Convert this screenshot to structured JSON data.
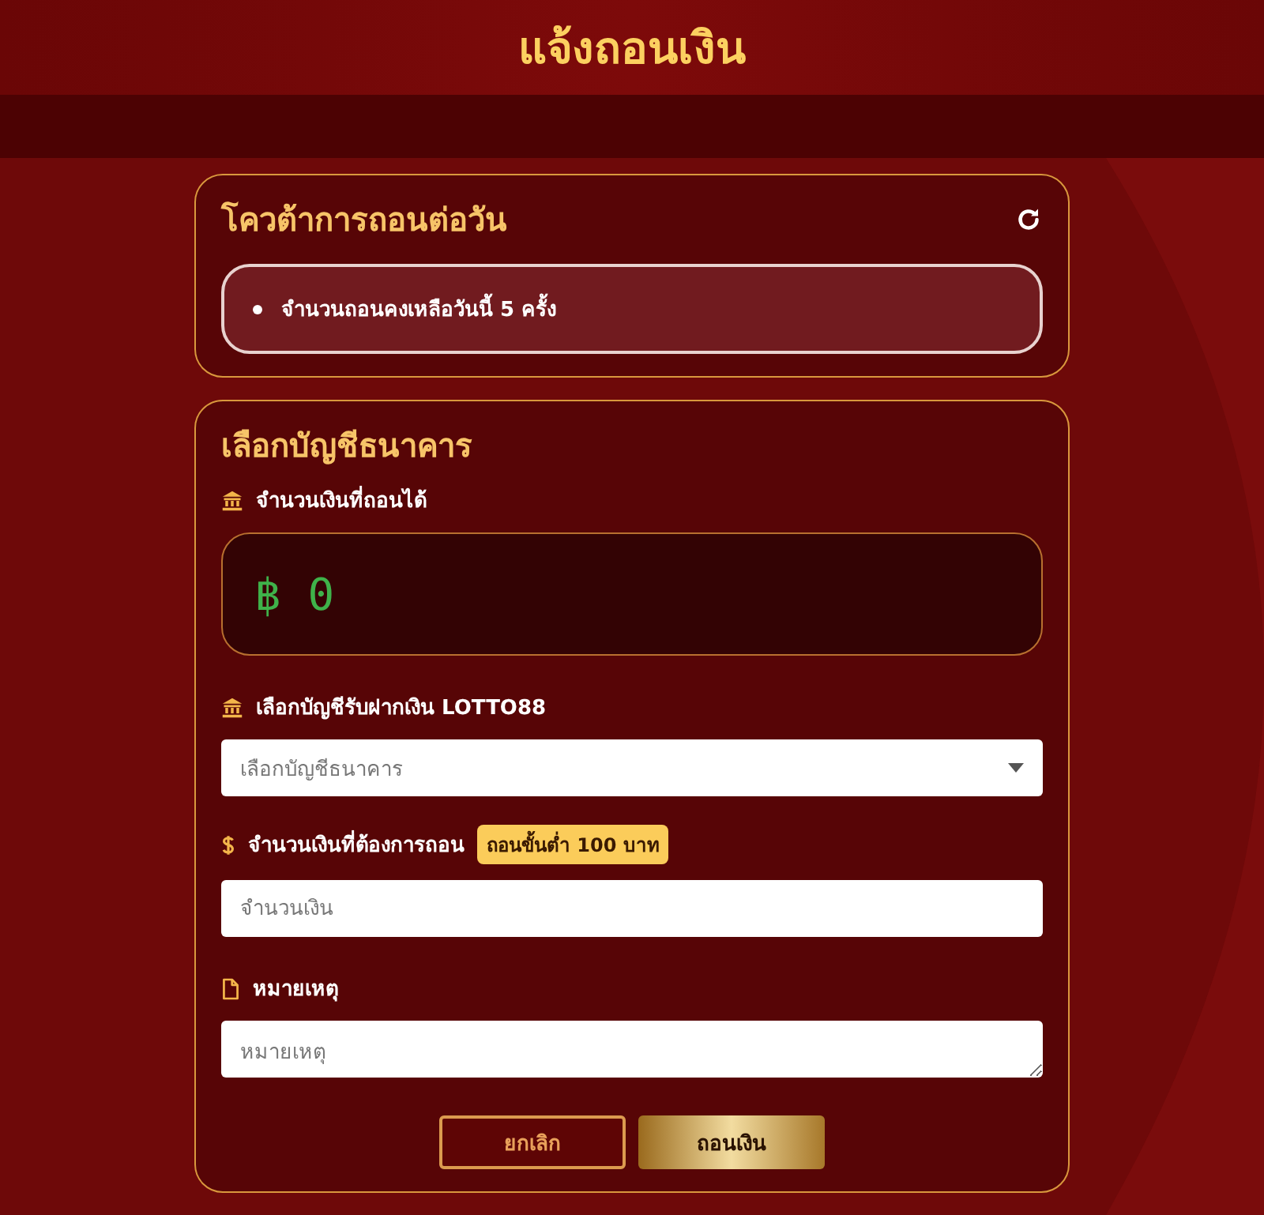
{
  "header": {
    "title": "แจ้งถอนเงิน"
  },
  "quota": {
    "title": "โควต้าการถอนต่อวัน",
    "items": [
      "จำนวนถอนคงเหลือวันนี้ 5 ครั้ง"
    ]
  },
  "form": {
    "title": "เลือกบัญชีธนาคาร",
    "fields": [
      {
        "kind": "balance",
        "label": "จำนวนเงินที่ถอนได้",
        "value": "฿ 0"
      },
      {
        "kind": "select",
        "label": "เลือกบัญชีรับฝากเงิน LOTTO88",
        "placeholder": "เลือกบัญชีธนาคาร"
      },
      {
        "kind": "input",
        "label": "จำนวนเงินที่ต้องการถอน",
        "badge": "ถอนขั้นต่ำ 100 บาท",
        "placeholder": "จำนวนเงิน"
      },
      {
        "kind": "textarea",
        "label": "หมายเหตุ",
        "placeholder": "หมายเหตุ"
      }
    ],
    "buttons": [
      {
        "label": "ยกเลิก",
        "kind": "outline"
      },
      {
        "label": "ถอนเงิน",
        "kind": "primary"
      }
    ]
  }
}
